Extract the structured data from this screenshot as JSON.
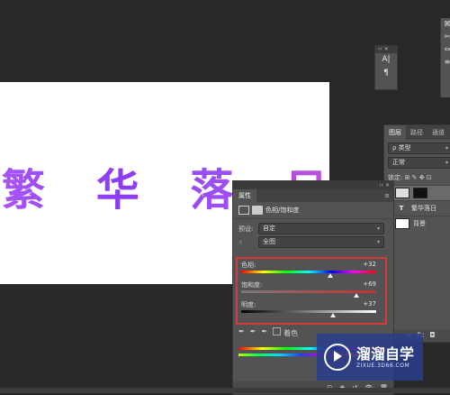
{
  "canvas": {
    "text": "繁 华 落 日"
  },
  "mini_dock": {
    "icons": [
      "A|",
      "¶"
    ]
  },
  "right_strip": {
    "icons": [
      "⌘",
      "✂",
      "⇔",
      "≡"
    ]
  },
  "layers_panel": {
    "tabs": [
      "图层",
      "路径",
      "通道"
    ],
    "kind_filter": "ρ 类型",
    "blend_mode": "正常",
    "lock_row": "锁定: ⊞ ✎ ✥ ⊡",
    "layers": [
      {
        "name": "",
        "type": "adjustment"
      },
      {
        "name": "繁华落日",
        "type": "text"
      },
      {
        "name": "背景",
        "type": "background"
      }
    ],
    "footer_icons": [
      "∞",
      "fx",
      "◘"
    ]
  },
  "properties_panel": {
    "tab": "属性",
    "header": "色相/饱和度",
    "preset_label": "预设:",
    "preset_value": "自定",
    "channel_value": "全图",
    "sliders": [
      {
        "label": "色相:",
        "value": "+32",
        "fraction": 0.66
      },
      {
        "label": "饱和度:",
        "value": "+69",
        "fraction": 0.85
      },
      {
        "label": "明度:",
        "value": "+37",
        "fraction": 0.68
      }
    ],
    "colorize_label": "着色",
    "footer_icons": [
      "⊡",
      "◉",
      "↺",
      "👁",
      "🗑"
    ]
  },
  "watermark": {
    "title": "溜溜自学",
    "url": "ZIXUE.3D66.COM"
  }
}
